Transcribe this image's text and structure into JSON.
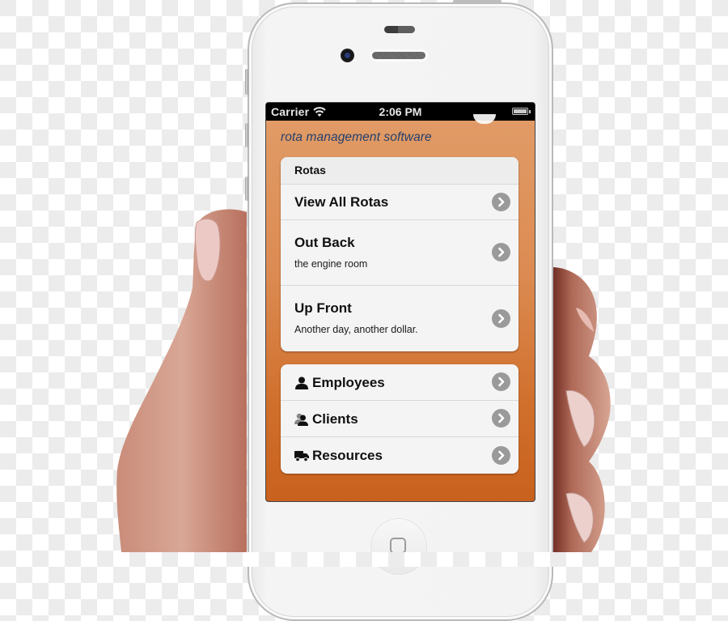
{
  "status_bar": {
    "carrier": "Carrier",
    "time": "2:06 PM",
    "wifi_icon": "wifi-icon",
    "battery_icon": "battery-full-icon"
  },
  "app": {
    "tagline": "rota management software",
    "accent_color": "#d8803f"
  },
  "rotas_group": {
    "header": "Rotas",
    "items": [
      {
        "title": "View All Rotas",
        "subtitle": "",
        "icon": "chevron-right-circle-icon"
      },
      {
        "title": "Out Back",
        "subtitle": "the engine room",
        "icon": "chevron-right-circle-icon"
      },
      {
        "title": "Up Front",
        "subtitle": "Another day, another dollar.",
        "icon": "chevron-right-circle-icon"
      }
    ]
  },
  "links_group": {
    "items": [
      {
        "title": "Employees",
        "icon": "user-icon"
      },
      {
        "title": "Clients",
        "icon": "users-icon"
      },
      {
        "title": "Resources",
        "icon": "truck-icon"
      }
    ]
  }
}
